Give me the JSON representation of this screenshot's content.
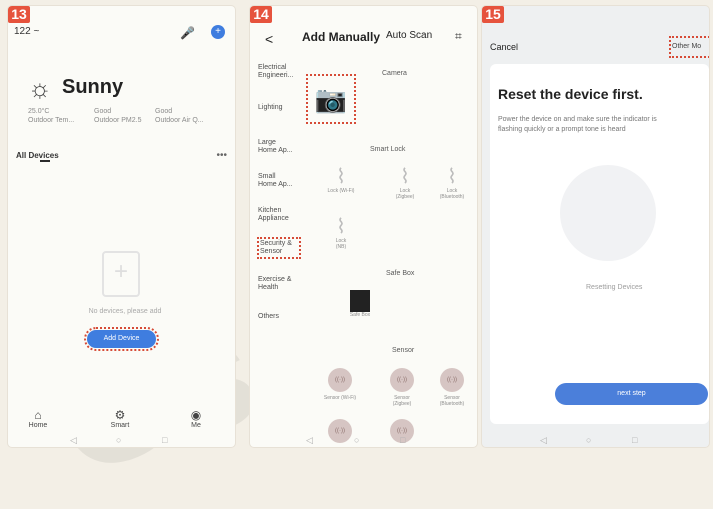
{
  "panels": {
    "p13": {
      "step": "13",
      "time": "122 ~",
      "weather": {
        "icon": "sun-icon",
        "title": "Sunny",
        "stats": [
          {
            "value": "25.0°C",
            "label": "Outdoor Tem..."
          },
          {
            "value": "Good",
            "label": "Outdoor PM2.5"
          },
          {
            "value": "Good",
            "label": "Outdoor Air Q..."
          }
        ]
      },
      "tab_all": "All Devices",
      "empty_text": "No devices, please add",
      "add_button": "Add Device",
      "nav": [
        {
          "label": "Home",
          "icon": "home-icon"
        },
        {
          "label": "Smart",
          "icon": "smart-icon"
        },
        {
          "label": "Me",
          "icon": "me-icon"
        }
      ]
    },
    "p14": {
      "step": "14",
      "back": "<",
      "title": "Add Manually",
      "auto": "Auto Scan",
      "scan": "⌗",
      "categories": [
        "Electrical\nEngineeri...",
        "Lighting",
        "Large\nHome Ap...",
        "Small\nHome Ap...",
        "Kitchen\nAppliance",
        "Security &\nSensor",
        "Exercise &\nHealth",
        "Others"
      ],
      "labels": {
        "camera": "Camera",
        "smart_lock": "Smart Lock",
        "safe_box": "Safe Box",
        "sensor": "Sensor"
      },
      "devices": [
        {
          "icon": "lock-icon",
          "label": "Lock (Wi-Fi)"
        },
        {
          "icon": "lock-icon",
          "label": "Lock\n(Zigbee)"
        },
        {
          "icon": "lock-icon",
          "label": "Lock\n(Bluetooth)"
        },
        {
          "icon": "lock-icon",
          "label": "Lock\n(NB)"
        }
      ],
      "sensors": [
        {
          "label": "Sensor (Wi-Fi)"
        },
        {
          "label": "Sensor\n(Zigbee)"
        },
        {
          "label": "Sensor\n(Bluetooth)"
        }
      ]
    },
    "p15": {
      "step": "15",
      "cancel": "Cancel",
      "other": "Other Mo",
      "title": "Reset the device first.",
      "desc": "Power the device on and make sure the indicator is flashing quickly or a prompt tone is heard",
      "resetting": "Resetting Devices",
      "next": "next step"
    }
  }
}
